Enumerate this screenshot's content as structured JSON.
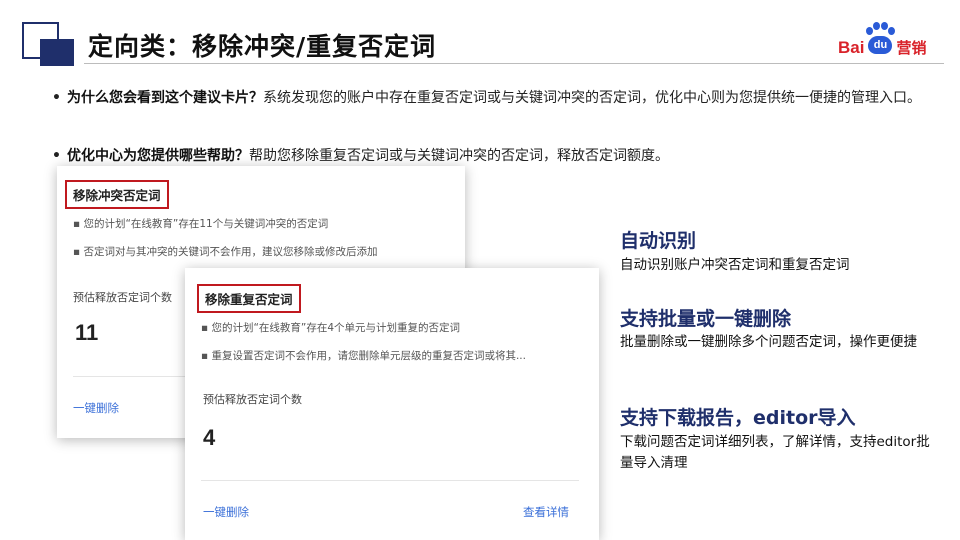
{
  "header": {
    "title": "定向类：移除冲突/重复否定词",
    "logo": {
      "bai": "Bai",
      "du": "du",
      "yingxiao": "营销"
    }
  },
  "bullets": [
    {
      "question": "为什么您会看到这个建议卡片？",
      "answer": "系统发现您的账户中存在重复否定词或与关键词冲突的否定词，优化中心则为您提供统一便捷的管理入口。"
    },
    {
      "question": "优化中心为您提供哪些帮助？",
      "answer": "帮助您移除重复否定词或与关键词冲突的否定词，释放否定词额度。"
    }
  ],
  "cards": [
    {
      "title": "移除冲突否定词",
      "lines": [
        "您的计划“在线教育”存在11个与关键词冲突的否定词",
        "否定词对与其冲突的关键词不会作用，建议您移除或修改后添加"
      ],
      "estimate_label": "预估释放否定词个数",
      "estimate_value": "11",
      "delete_link": "一键删除"
    },
    {
      "title": "移除重复否定词",
      "lines": [
        "您的计划“在线教育”存在4个单元与计划重复的否定词",
        "重复设置否定词不会作用，请您删除单元层级的重复否定词或将其..."
      ],
      "estimate_label": "预估释放否定词个数",
      "estimate_value": "4",
      "delete_link": "一键删除",
      "detail_link": "查看详情"
    }
  ],
  "features": [
    {
      "title": "自动识别",
      "desc": "自动识别账户冲突否定词和重复否定词"
    },
    {
      "title": "支持批量或一键删除",
      "desc": "批量删除或一键删除多个问题否定词，操作更便捷"
    },
    {
      "title": "支持下载报告，editor导入",
      "desc": "下载问题否定词详细列表，了解详情，支持editor批量导入清理"
    }
  ],
  "colors": {
    "accent": "#1f2f6b",
    "highlight_border": "#c0191f",
    "link": "#3a6fd8",
    "logo_red": "#d9232a",
    "logo_blue": "#2a5bd7"
  }
}
